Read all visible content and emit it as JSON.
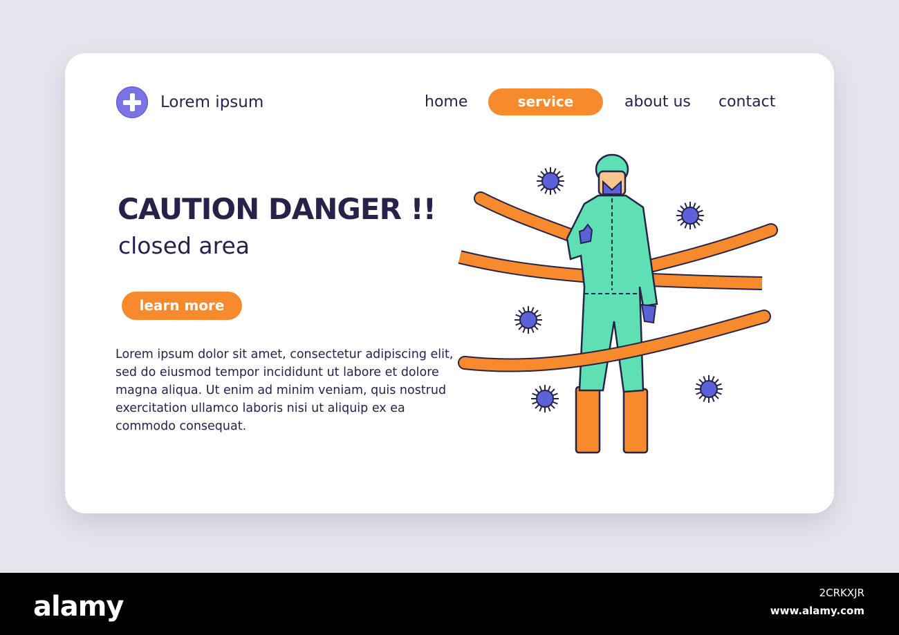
{
  "brand": {
    "logo_text": "Lorem ipsum"
  },
  "nav": {
    "items": [
      "home",
      "service",
      "about us",
      "contact"
    ],
    "active": "service"
  },
  "hero": {
    "headline": "CAUTION DANGER !!",
    "subhead": "closed area",
    "cta_label": "learn more",
    "body": "Lorem ipsum dolor sit amet, consectetur adipiscing elit, sed do eiusmod tempor incididunt ut labore et dolore magna aliqua. Ut enim ad minim veniam, quis nostrud exercitation ullamco laboris nisi ut aliquip ex ea commodo consequat."
  },
  "illustration": {
    "subject": "person in hazmat suit with stop gesture",
    "icons": [
      "virus-icon",
      "caution-tape"
    ]
  },
  "colors": {
    "accent": "#f68a2c",
    "primary_text": "#26234a",
    "logo": "#7b72e6",
    "suit": "#5fe0b4",
    "virus": "#5b62d8"
  },
  "footer": {
    "watermark": "alamy",
    "image_id": "2CRKXJR",
    "url": "www.alamy.com"
  }
}
